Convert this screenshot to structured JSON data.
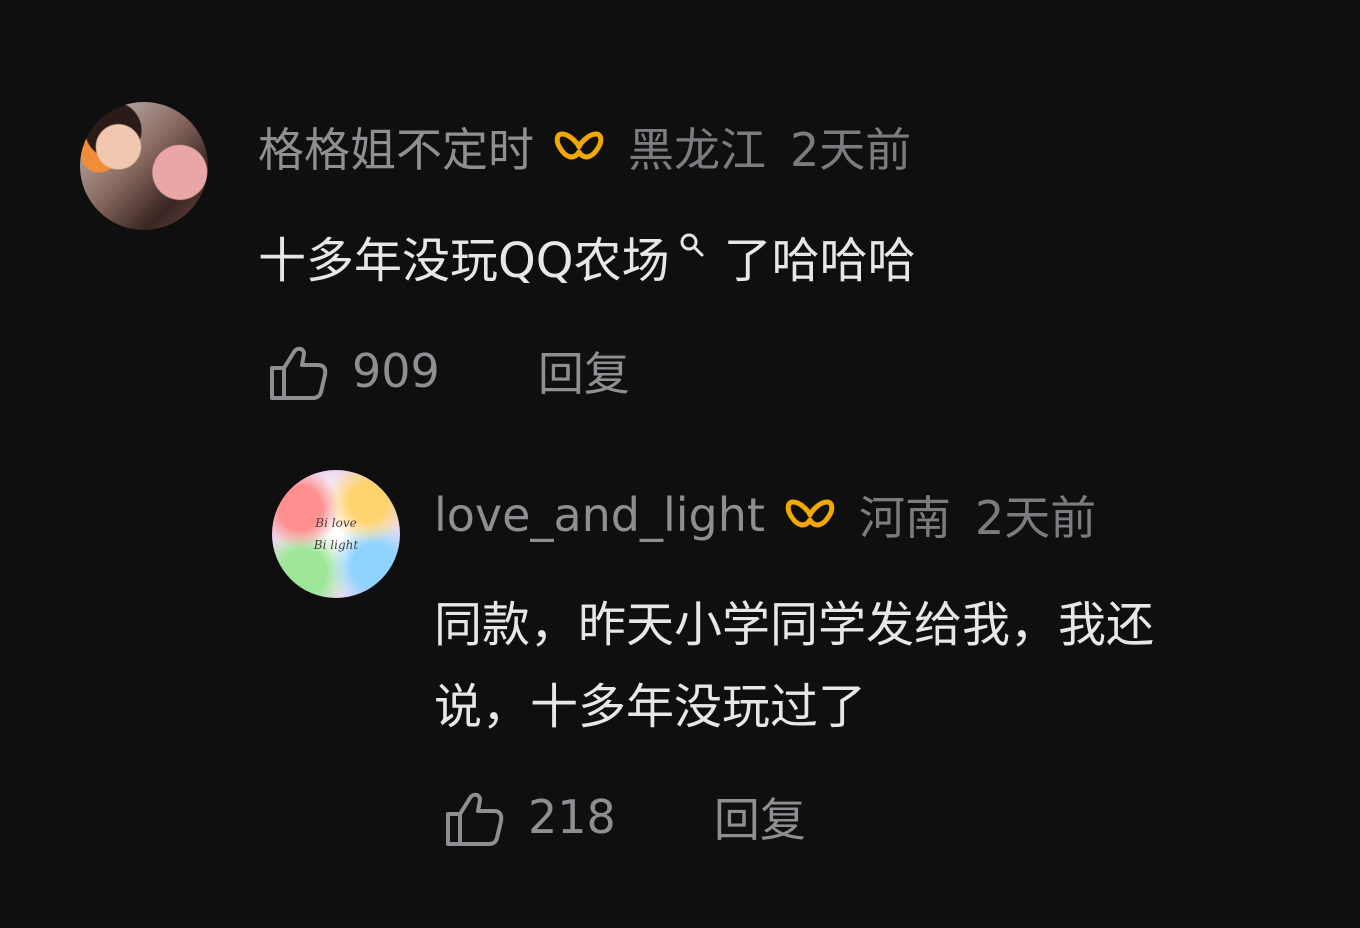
{
  "comments": [
    {
      "name": "格格姐不定时",
      "location": "黑龙江",
      "time": "2天前",
      "text_before_icon": "十多年没玩QQ农场",
      "text_after_icon": "了哈哈哈",
      "likes": "909",
      "reply": "回复",
      "badge_color": "#f2a800"
    },
    {
      "name": "love_and_light",
      "location": "河南",
      "time": "2天前",
      "text_line1": "同款，昨天小学同学发给我，我还",
      "text_line2": "说，十多年没玩过了",
      "likes": "218",
      "reply": "回复",
      "badge_color": "#f2a800",
      "avatar_text_line1": "Bi love",
      "avatar_text_line2": "Bi light"
    }
  ]
}
